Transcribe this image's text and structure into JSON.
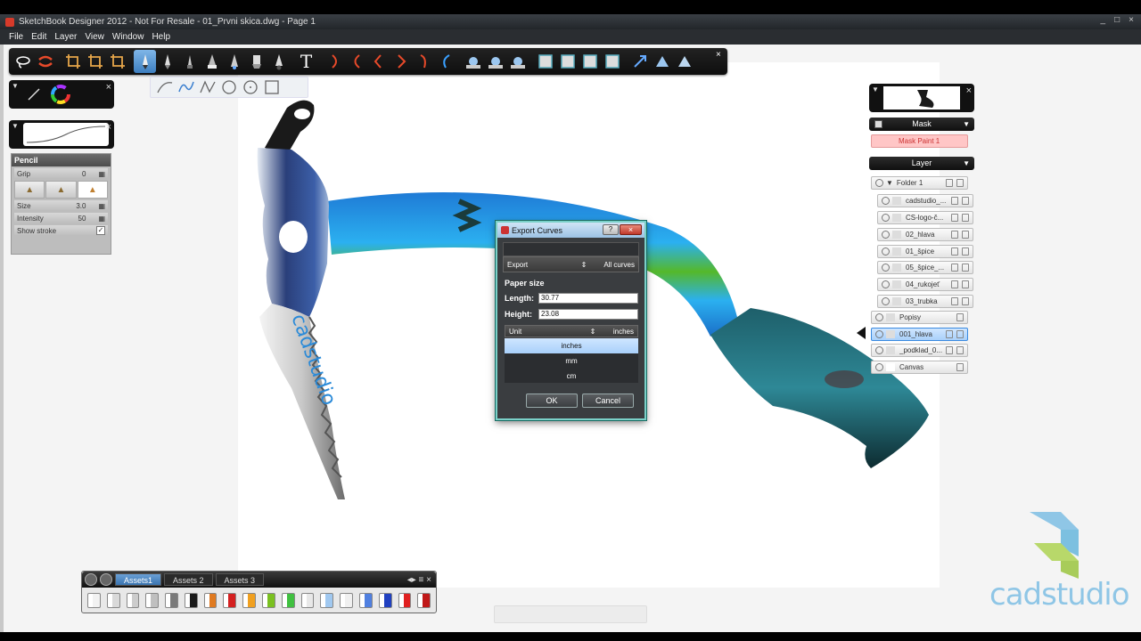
{
  "window": {
    "title": "SketchBook Designer 2012 - Not For Resale - 01_Prvni skica.dwg - Page 1",
    "controls": [
      "_",
      "□",
      "×"
    ]
  },
  "menu": [
    "File",
    "Edit",
    "Layer",
    "View",
    "Window",
    "Help"
  ],
  "toolbar": {
    "text_tool_glyph": "T",
    "close_glyph": "×"
  },
  "brush_properties": {
    "title": "Pencil",
    "grip": {
      "label": "Grip",
      "value": "0"
    },
    "size": {
      "label": "Size",
      "value": "3.0"
    },
    "intensity": {
      "label": "Intensity",
      "value": "50"
    },
    "show_stroke": {
      "label": "Show stroke",
      "checked": "✓"
    }
  },
  "panels": {
    "close_glyph": "×",
    "chevron_glyph": "▼"
  },
  "mask": {
    "header": "Mask",
    "layer_label": "Mask Paint 1"
  },
  "layers": {
    "header": "Layer",
    "items": [
      {
        "name": "Folder 1"
      },
      {
        "name": "cadstudio_..."
      },
      {
        "name": "CS-logo-č..."
      },
      {
        "name": "02_hlava"
      },
      {
        "name": "01_špice"
      },
      {
        "name": "05_špice_..."
      },
      {
        "name": "04_rukojeť"
      },
      {
        "name": "03_trubka"
      },
      {
        "name": "Popisy"
      },
      {
        "name": "001_hlava"
      },
      {
        "name": "_podklad_0..."
      },
      {
        "name": "Canvas"
      }
    ]
  },
  "dialog": {
    "title": "Export Curves",
    "help": "?",
    "close": "×",
    "export_label": "Export",
    "export_spinner": "⇕",
    "export_value": "All curves",
    "section": "Paper size",
    "length_label": "Length:",
    "length_value": "30.77",
    "height_label": "Height:",
    "height_value": "23.08",
    "unit_label": "Unit",
    "unit_spinner": "⇕",
    "unit_value": "inches",
    "unit_options": [
      "inches",
      "mm",
      "cm"
    ],
    "ok": "OK",
    "cancel": "Cancel"
  },
  "assets": {
    "tabs": [
      "Assets1",
      "Assets 2",
      "Assets 3"
    ],
    "tail_icons": "◂▸ ≡ ×",
    "swatch_colors": [
      "#f2f2f2",
      "#d9d9d9",
      "#cccccc",
      "#bfbfbf",
      "#7a7a7a",
      "#1a1a1a",
      "#e07a20",
      "#d42020",
      "#f0a020",
      "#7ac020",
      "#40c040",
      "#e8e8e8",
      "#a0c8f0",
      "#f0f0f0",
      "#5080e0",
      "#2040c0",
      "#e02020",
      "#c01818"
    ]
  },
  "watermark": {
    "text": "cadstudio"
  },
  "colors": {
    "accent": "#3d7fc0",
    "selection": "#a9d0fa",
    "dialog_border": "#7ad0c8"
  }
}
